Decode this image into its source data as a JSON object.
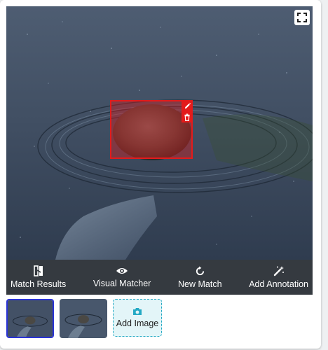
{
  "viewer": {
    "fullscreen_icon": "expand-icon",
    "annotation": {
      "tools": [
        "pencil-icon",
        "trash-icon"
      ],
      "fill_color": "#dc1c1c"
    }
  },
  "toolbar": {
    "items": [
      {
        "label": "Match Results",
        "icon": "match-results-icon"
      },
      {
        "label": "Visual Matcher",
        "icon": "eye-icon"
      },
      {
        "label": "New Match",
        "icon": "refresh-icon"
      },
      {
        "label": "Add Annotation",
        "icon": "magic-wand-icon"
      }
    ]
  },
  "thumbnails": {
    "selected_index": 0,
    "add_label": "Add Image",
    "add_icon": "camera-icon"
  },
  "colors": {
    "toolbar_bg": "#353a40",
    "accent": "#24a9c4",
    "selected_border": "#2a33d6"
  }
}
